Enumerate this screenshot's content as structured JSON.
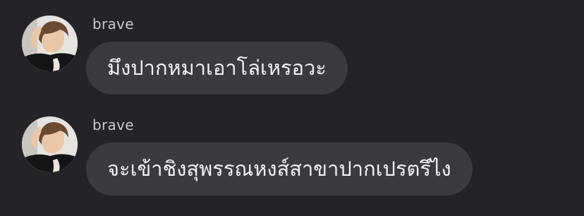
{
  "messages": [
    {
      "sender": "brave",
      "text": "มึงปากหมาเอาโล่เหรอวะ"
    },
    {
      "sender": "brave",
      "text": "จะเข้าชิงสุพรรณหงส์สาขาปากเปรตรึไง"
    }
  ],
  "colors": {
    "background": "#242428",
    "bubble": "#3a3a3f",
    "message_text": "#f2f2f5",
    "sender_text": "#c8c8cc"
  },
  "icons": {
    "avatar": "profile-photo"
  }
}
